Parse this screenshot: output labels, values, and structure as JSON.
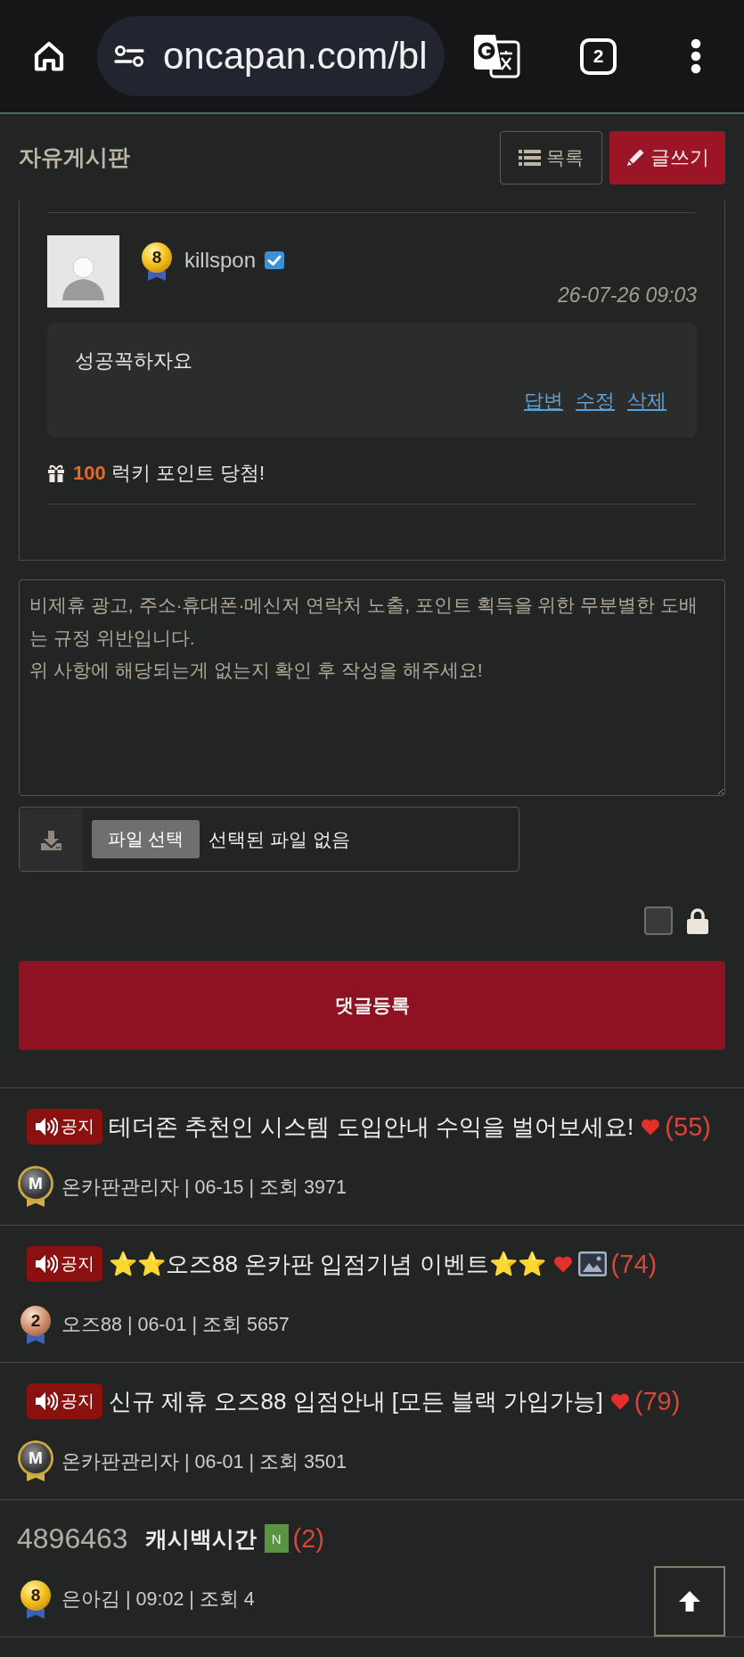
{
  "browser": {
    "url": "oncapan.com/bl",
    "tab_count": "2"
  },
  "header": {
    "title": "자유게시판",
    "buttons": [
      {
        "kind": "list",
        "label": "목록"
      },
      {
        "kind": "write",
        "label": "글쓰기"
      }
    ]
  },
  "comment": {
    "author": "killspon",
    "badge": {
      "kind": "gold",
      "label": "8"
    },
    "verified": true,
    "date": "26-07-26 09:03",
    "body": "성공꼭하자요",
    "actions": [
      "답변",
      "수정",
      "삭제"
    ],
    "reward": "**100** 럭키 포인트 당첨!"
  },
  "form": {
    "placeholder": "비제휴 광고, 주소·휴대폰·메신저 연락처 노출, 포인트 획득을 위한 무분별한 도배는 규정 위반입니다.\n위 사항에 해당되는게 없는지 확인 후 작성을 해주세요!",
    "file_button": "파일 선택",
    "file_status": "선택된 파일 없음",
    "secret": {
      "checked": false
    },
    "submit": "댓글등록"
  },
  "posts": [
    {
      "kind": "notice",
      "badge_label": "공지",
      "title": "테더존 추천인 시스템 도입안내 수익을 벌어보세요!",
      "heart": true,
      "has_image": false,
      "comment_count": "(55)",
      "author_badge": {
        "kind": "admin",
        "label": "M"
      },
      "meta": "온카판관리자 | 06-15 | 조회 3971"
    },
    {
      "kind": "notice",
      "badge_label": "공지",
      "title": "⭐⭐오즈88 온카판 입점기념 이벤트⭐⭐",
      "heart": true,
      "has_image": true,
      "comment_count": "(74)",
      "author_badge": {
        "kind": "bronze",
        "label": "2"
      },
      "meta": "오즈88 | 06-01 | 조회 5657"
    },
    {
      "kind": "notice",
      "badge_label": "공지",
      "title": "신규 제휴 오즈88 입점안내 [모든 블랙 가입가능]",
      "heart": true,
      "has_image": false,
      "comment_count": "(79)",
      "author_badge": {
        "kind": "admin",
        "label": "M"
      },
      "meta": "온카판관리자 | 06-01 | 조회 3501"
    },
    {
      "kind": "post",
      "number": "4896463",
      "title": "캐시백시간",
      "new_badge": "N",
      "heart": false,
      "has_image": false,
      "comment_count": "(2)",
      "author_badge": {
        "kind": "gold",
        "label": "8"
      },
      "meta": "은아김 | 09:02 | 조회 4"
    }
  ]
}
